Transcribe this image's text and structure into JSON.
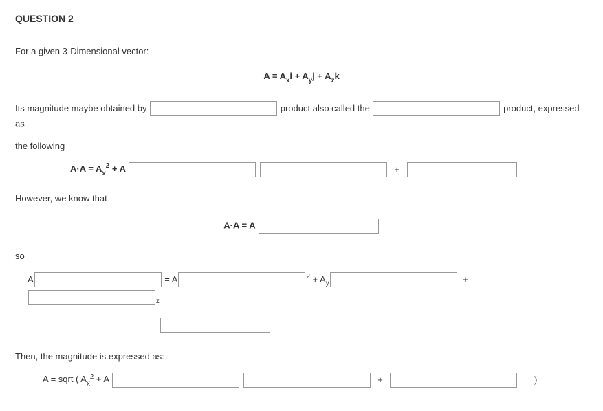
{
  "title": "QUESTION 2",
  "intro": "For a given 3-Dimensional vector:",
  "vector_def": {
    "lead": "A = A",
    "x": "x",
    "i": "i",
    "plus1": " + A",
    "y": "y",
    "j": "j",
    "plus2": " + A",
    "z": "z",
    "k": "k"
  },
  "line1": {
    "pre": "Its magnitude maybe obtained by ",
    "mid": " product also called the ",
    "post": " product, expressed as",
    "after": "the following"
  },
  "line2": {
    "lead": "A·A = A",
    "sub": "x",
    "sup": "2",
    "plusA": " + A",
    "plus": "+"
  },
  "line3": "However, we know that",
  "line4": {
    "lead": "A·A = A"
  },
  "line5": "so",
  "line6": {
    "A": "A",
    "eqA": " = A",
    "two": "2",
    "plusAy": " + A",
    "ysub": "y",
    "plus": "+",
    "zsub": "z"
  },
  "line7": "Then, the magnitude is expressed as:",
  "line8": {
    "lead": "A = sqrt (   A",
    "sub": "x",
    "sup": "2",
    "plusA": "    +    A",
    "plus": "+",
    "close": ")"
  }
}
